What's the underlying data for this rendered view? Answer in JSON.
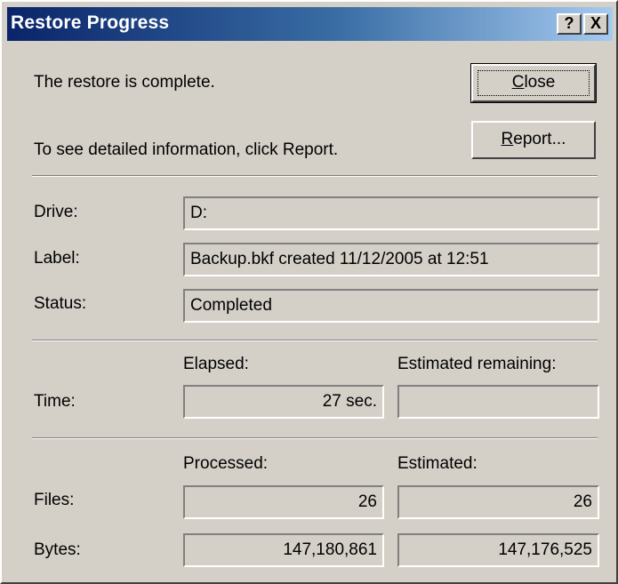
{
  "window": {
    "title": "Restore Progress",
    "help_button": "?",
    "close_button": "X"
  },
  "message": {
    "complete": "The restore is complete.",
    "detail": "To see detailed information, click Report."
  },
  "buttons": {
    "close_label": "Close",
    "close_mnemonic": "C",
    "close_rest": "lose",
    "report_label": "Report...",
    "report_mnemonic": "R",
    "report_rest": "eport..."
  },
  "info": {
    "drive_label": "Drive:",
    "drive_value": "D:",
    "label_label": "Label:",
    "label_value": "Backup.bkf created 11/12/2005 at 12:51",
    "status_label": "Status:",
    "status_value": "Completed"
  },
  "time": {
    "elapsed_header": "Elapsed:",
    "remaining_header": "Estimated remaining:",
    "row_label": "Time:",
    "elapsed_value": "27 sec.",
    "remaining_value": ""
  },
  "counts": {
    "processed_header": "Processed:",
    "estimated_header": "Estimated:",
    "files_label": "Files:",
    "files_processed": "26",
    "files_estimated": "26",
    "bytes_label": "Bytes:",
    "bytes_processed": "147,180,861",
    "bytes_estimated": "147,176,525"
  },
  "colors": {
    "dialog_face": "#d4d0c8",
    "titlebar_start": "#0a246a",
    "titlebar_end": "#a6caf0"
  }
}
